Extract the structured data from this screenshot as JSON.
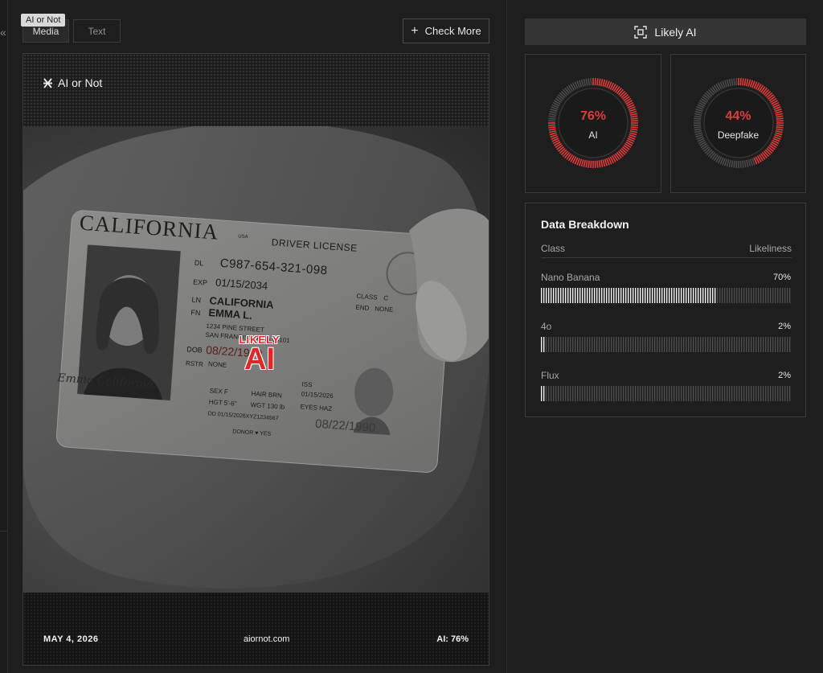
{
  "tooltip": "AI or Not",
  "tabs": [
    {
      "label": "Media",
      "active": true
    },
    {
      "label": "Text",
      "active": false
    }
  ],
  "check_more": {
    "label": "Check More",
    "icon": "plus-icon"
  },
  "card": {
    "brand": "AI or Not",
    "license": {
      "state": "CALIFORNIA",
      "usa": "USA",
      "type": "DRIVER LICENSE",
      "dl_label": "DL",
      "dl": "C987-654-321-098",
      "exp_label": "EXP",
      "exp": "01/15/2034",
      "ln_label": "LN",
      "ln": "CALIFORNIA",
      "fn_label": "FN",
      "fn": "EMMA L.",
      "addr1": "1234 PINE STREET",
      "addr2": "SAN FRANCISCO, CA 94101",
      "dob_label": "DOB",
      "dob": "08/22/1990",
      "rstr_label": "RSTR",
      "rstr": "NONE",
      "class_label": "CLASS",
      "class": "C",
      "end_label": "END",
      "end": "NONE",
      "iss_label": "ISS",
      "iss": "01/15/2026",
      "eyes": "EYES HAZ",
      "sex": "SEX  F",
      "hair": "HAIR  BRN",
      "hgt": "HGT  5'-6\"",
      "wgt": "WGT  130 lb",
      "dd": "DD  01/15/2026XYZ1234567",
      "dob_big": "08/22/1990",
      "donor": "DONOR ♥ YES",
      "signature": "Emma California"
    },
    "stamp_top": "LIKELY",
    "stamp_bottom": "AI",
    "footer": {
      "date": "MAY 4, 2026",
      "site": "aiornot.com",
      "score": "AI: 76%"
    }
  },
  "verdict": {
    "label": "Likely AI",
    "icon": "scan-frame-icon"
  },
  "gauges": [
    {
      "name": "ai",
      "percent": 76,
      "label_pct": "76%",
      "label": "AI"
    },
    {
      "name": "deepfake",
      "percent": 44,
      "label_pct": "44%",
      "label": "Deepfake"
    }
  ],
  "breakdown": {
    "title": "Data Breakdown",
    "col_class": "Class",
    "col_likeliness": "Likeliness",
    "rows": [
      {
        "label": "Nano Banana",
        "value": "70%",
        "percent": 70
      },
      {
        "label": "4o",
        "value": "2%",
        "percent": 2
      },
      {
        "label": "Flux",
        "value": "2%",
        "percent": 2
      }
    ]
  },
  "colors": {
    "accent": "#e23b3b",
    "background": "#1e1e1e",
    "border": "#3a3a3a"
  }
}
